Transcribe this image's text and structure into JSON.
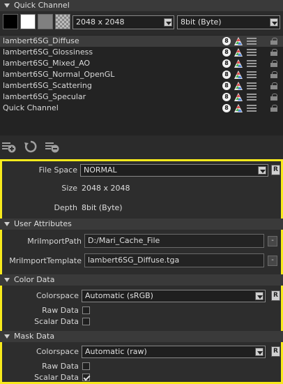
{
  "header": {
    "title": "Quick Channel"
  },
  "toolbar": {
    "size_value": "2048 x 2048",
    "depth_value": "8bit  (Byte)"
  },
  "channels": [
    {
      "name": "lambert6SG_Diffuse",
      "badge": "8",
      "selected": true
    },
    {
      "name": "lambert6SG_Glossiness",
      "badge": "8",
      "selected": false
    },
    {
      "name": "lambert6SG_Mixed_AO",
      "badge": "8",
      "selected": false
    },
    {
      "name": "lambert6SG_Normal_OpenGL",
      "badge": "8",
      "selected": false
    },
    {
      "name": "lambert6SG_Scattering",
      "badge": "8",
      "selected": false
    },
    {
      "name": "lambert6SG_Specular",
      "badge": "8",
      "selected": false
    },
    {
      "name": "Quick Channel",
      "badge": "8",
      "selected": false
    }
  ],
  "props": {
    "file_space_label": "File Space",
    "file_space_value": "NORMAL",
    "size_label": "Size",
    "size_value": "2048 x 2048",
    "depth_label": "Depth",
    "depth_value": "8bit  (Byte)",
    "reset_label": "R"
  },
  "user_attributes": {
    "header": "User Attributes",
    "import_path_label": "MriImportPath",
    "import_path_value": "D:/Mari_Cache_File",
    "import_template_label": "MriImportTemplate",
    "import_template_value": "lambert6SG_Diffuse.tga",
    "clear_label": "-"
  },
  "color_data": {
    "header": "Color Data",
    "colorspace_label": "Colorspace",
    "colorspace_value": "Automatic (sRGB)",
    "raw_label": "Raw Data",
    "raw_checked": false,
    "scalar_label": "Scalar Data",
    "scalar_checked": false
  },
  "mask_data": {
    "header": "Mask Data",
    "colorspace_label": "Colorspace",
    "colorspace_value": "Automatic (raw)",
    "raw_label": "Raw Data",
    "raw_checked": false,
    "scalar_label": "Scalar Data",
    "scalar_checked": true
  },
  "colors": {
    "highlight": "#f7ea1c",
    "panel_bg": "#2d2d2d"
  }
}
